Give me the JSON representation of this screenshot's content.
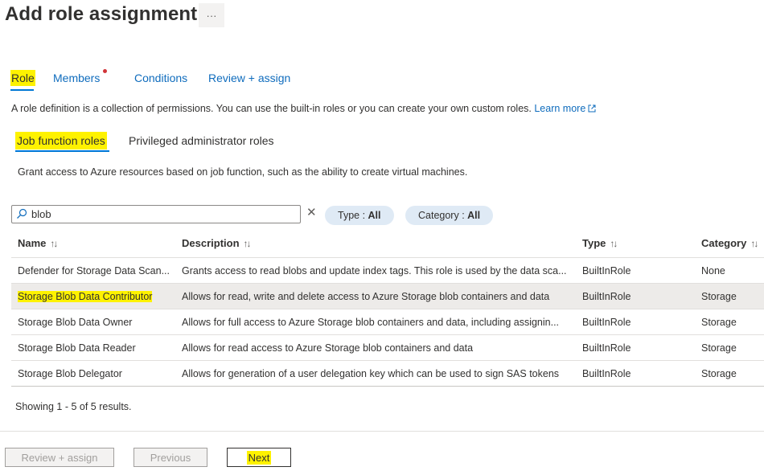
{
  "header": {
    "title": "Add role assignment",
    "more_label": "···"
  },
  "tabs": [
    {
      "label": "Role",
      "active": true
    },
    {
      "label": "Members",
      "active": false
    },
    {
      "label": "Conditions",
      "active": false
    },
    {
      "label": "Review + assign",
      "active": false
    }
  ],
  "role_description": {
    "text": "A role definition is a collection of permissions. You can use the built-in roles or you can create your own custom roles.",
    "link": "Learn more",
    "link_icon": "external-link-icon"
  },
  "subtabs": [
    {
      "label": "Job function roles",
      "active": true
    },
    {
      "label": "Privileged administrator roles",
      "active": false
    }
  ],
  "subtab_description": "Grant access to Azure resources based on job function, such as the ability to create virtual machines.",
  "search": {
    "value": "blob",
    "placeholder": "",
    "clear_symbol": "✕"
  },
  "filters": [
    {
      "label": "Type : ",
      "value": "All"
    },
    {
      "label": "Category : ",
      "value": "All"
    }
  ],
  "table": {
    "sort_symbol": "↑↓",
    "columns": [
      "Name",
      "Description",
      "Type",
      "Category"
    ],
    "rows": [
      {
        "name": "Defender for Storage Data Scan...",
        "description": "Grants access to read blobs and update index tags. This role is used by the data sca...",
        "type": "BuiltInRole",
        "category": "None",
        "selected": false
      },
      {
        "name": "Storage Blob Data Contributor",
        "description": "Allows for read, write and delete access to Azure Storage blob containers and data",
        "type": "BuiltInRole",
        "category": "Storage",
        "selected": true
      },
      {
        "name": "Storage Blob Data Owner",
        "description": "Allows for full access to Azure Storage blob containers and data, including assignin...",
        "type": "BuiltInRole",
        "category": "Storage",
        "selected": false
      },
      {
        "name": "Storage Blob Data Reader",
        "description": "Allows for read access to Azure Storage blob containers and data",
        "type": "BuiltInRole",
        "category": "Storage",
        "selected": false
      },
      {
        "name": "Storage Blob Delegator",
        "description": "Allows for generation of a user delegation key which can be used to sign SAS tokens",
        "type": "BuiltInRole",
        "category": "Storage",
        "selected": false
      }
    ]
  },
  "results_summary": "Showing 1 - 5 of 5 results.",
  "footer": {
    "review_assign": "Review + assign",
    "previous": "Previous",
    "next": "Next"
  },
  "colors": {
    "accent": "#0078d4",
    "link": "#0f6cbd",
    "highlight": "#fef200",
    "notification_dot": "#d13438",
    "pill_bg": "#dfeaf5",
    "selected_row": "#edebe9"
  }
}
